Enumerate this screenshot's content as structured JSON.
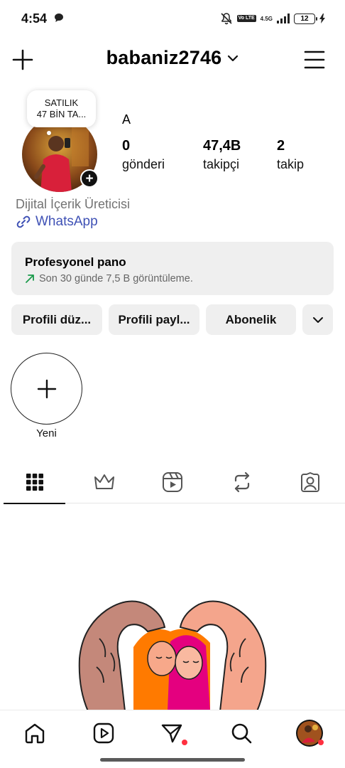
{
  "status_bar": {
    "time": "4:54",
    "network_label": "4.5G",
    "lte_label": "Vo LTE",
    "battery_level": "12"
  },
  "header": {
    "username": "babaniz2746"
  },
  "profile": {
    "note_line1": "SATILIK",
    "note_line2": "47 BİN TA...",
    "display_name": "A",
    "stats": [
      {
        "value": "0",
        "label": "gönderi"
      },
      {
        "value": "47,4B",
        "label": "takipçi"
      },
      {
        "value": "2",
        "label": "takip"
      }
    ],
    "category": "Dijital İçerik Üreticisi",
    "link": "WhatsApp"
  },
  "dashboard": {
    "title": "Profesyonel pano",
    "subtitle": "Son 30 günde 7,5 B görüntüleme."
  },
  "buttons": {
    "edit_profile": "Profili düz...",
    "share_profile": "Profili payl...",
    "subscription": "Abonelik"
  },
  "highlights": {
    "new_label": "Yeni"
  },
  "tabs": [
    "grid-icon",
    "crown-icon",
    "reels-icon",
    "repost-icon",
    "tagged-icon"
  ],
  "colors": {
    "link": "#3f51b5",
    "notification": "#ff3040",
    "card_bg": "#efefef"
  }
}
